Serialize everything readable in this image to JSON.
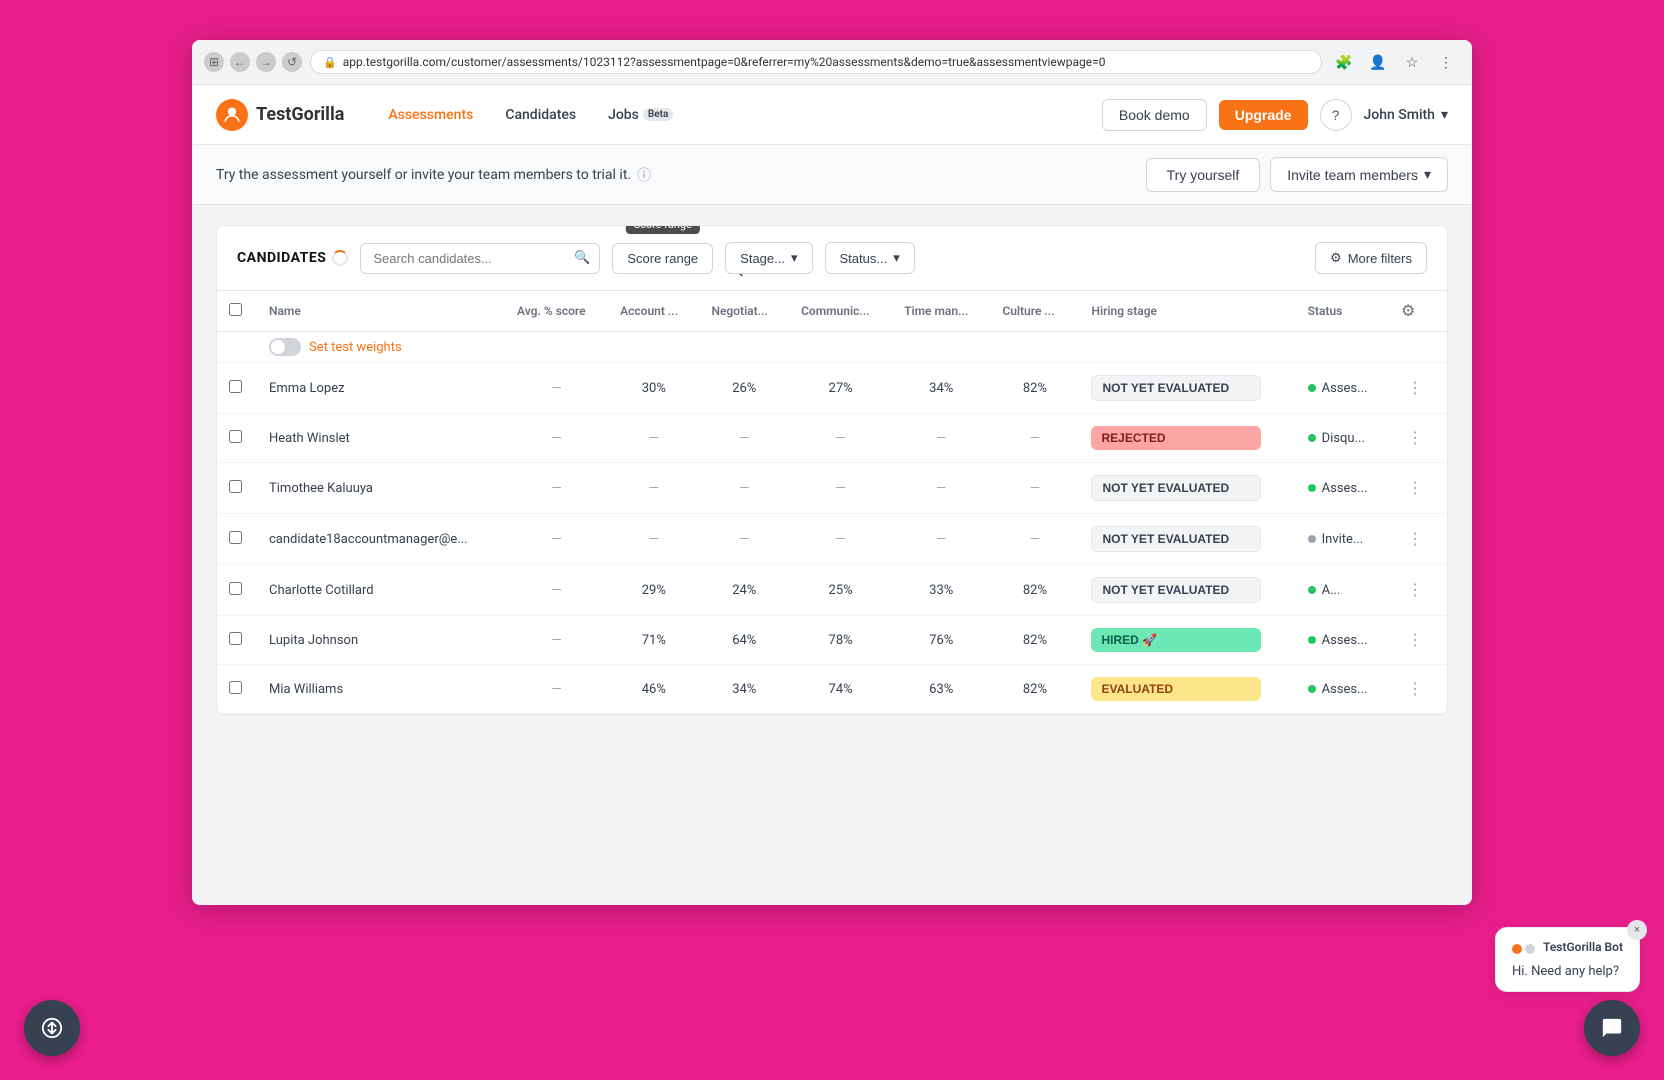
{
  "browser": {
    "url": "app.testgorilla.com/customer/assessments/1023112?assessmentpage=0&referrer=my%20assessments&demo=true&assessmentviewpage=0",
    "tabs": [
      "tab1"
    ]
  },
  "navbar": {
    "logo_text": "TestGorilla",
    "nav_links": [
      {
        "label": "Assessments",
        "active": true
      },
      {
        "label": "Candidates",
        "active": false
      },
      {
        "label": "Jobs",
        "active": false,
        "badge": "Beta"
      }
    ],
    "book_demo_label": "Book demo",
    "upgrade_label": "Upgrade",
    "user_name": "John Smith"
  },
  "trial_banner": {
    "text": "Try the assessment yourself or invite your team members to trial it.",
    "try_yourself_label": "Try yourself",
    "invite_label": "Invite team members"
  },
  "candidates_section": {
    "title": "CANDIDATES",
    "search_placeholder": "Search candidates...",
    "score_range_label": "Score range",
    "stage_placeholder": "Stage...",
    "status_placeholder": "Status...",
    "more_filters_label": "More filters",
    "set_test_weights_label": "Set test weights",
    "columns": [
      {
        "key": "name",
        "label": "Name"
      },
      {
        "key": "avg_score",
        "label": "Avg. % score"
      },
      {
        "key": "account",
        "label": "Account ..."
      },
      {
        "key": "negotiat",
        "label": "Negotiat..."
      },
      {
        "key": "communic",
        "label": "Communic..."
      },
      {
        "key": "time_man",
        "label": "Time man..."
      },
      {
        "key": "culture",
        "label": "Culture ..."
      },
      {
        "key": "hiring_stage",
        "label": "Hiring stage"
      },
      {
        "key": "status",
        "label": "Status"
      }
    ],
    "rows": [
      {
        "id": 1,
        "name": "Emma Lopez",
        "avg_score": "—",
        "account": "30%",
        "negotiat": "26%",
        "communic": "27%",
        "time_man": "34%",
        "culture": "82%",
        "hiring_stage": "NOT YET EVALUATED",
        "hiring_stage_type": "not-evaluated",
        "status_dot": "green",
        "status_text": "Asses..."
      },
      {
        "id": 2,
        "name": "Heath Winslet",
        "avg_score": "—",
        "account": "—",
        "negotiat": "—",
        "communic": "—",
        "time_man": "—",
        "culture": "—",
        "hiring_stage": "REJECTED",
        "hiring_stage_type": "rejected",
        "status_dot": "green",
        "status_text": "Disqu..."
      },
      {
        "id": 3,
        "name": "Timothee Kaluuya",
        "avg_score": "—",
        "account": "—",
        "negotiat": "—",
        "communic": "—",
        "time_man": "—",
        "culture": "—",
        "hiring_stage": "NOT YET EVALUATED",
        "hiring_stage_type": "not-evaluated",
        "status_dot": "green",
        "status_text": "Asses..."
      },
      {
        "id": 4,
        "name": "candidate18accountmanager@e...",
        "avg_score": "—",
        "account": "—",
        "negotiat": "—",
        "communic": "—",
        "time_man": "—",
        "culture": "—",
        "hiring_stage": "NOT YET EVALUATED",
        "hiring_stage_type": "not-evaluated",
        "status_dot": "gray",
        "status_text": "Invite..."
      },
      {
        "id": 5,
        "name": "Charlotte Cotillard",
        "avg_score": "—",
        "account": "29%",
        "negotiat": "24%",
        "communic": "25%",
        "time_man": "33%",
        "culture": "82%",
        "hiring_stage": "NOT YET EVALUATED",
        "hiring_stage_type": "not-evaluated",
        "status_dot": "green",
        "status_text": "A..."
      },
      {
        "id": 6,
        "name": "Lupita Johnson",
        "avg_score": "—",
        "account": "71%",
        "negotiat": "64%",
        "communic": "78%",
        "time_man": "76%",
        "culture": "82%",
        "hiring_stage": "HIRED 🚀",
        "hiring_stage_type": "hired",
        "status_dot": "green",
        "status_text": "Asses..."
      },
      {
        "id": 7,
        "name": "Mia Williams",
        "avg_score": "—",
        "account": "46%",
        "negotiat": "34%",
        "communic": "74%",
        "time_man": "63%",
        "culture": "82%",
        "hiring_stage": "EVALUATED",
        "hiring_stage_type": "evaluated",
        "status_dot": "green",
        "status_text": "Asses..."
      }
    ]
  },
  "chat_widget": {
    "close_label": "×",
    "bot_name": "TestGorilla Bot",
    "message": "Hi. Need any help?",
    "dot_colors": [
      "#f97316",
      "#d1d5db"
    ],
    "launcher_icon": "💬"
  },
  "score_range_tooltip": "Score range"
}
